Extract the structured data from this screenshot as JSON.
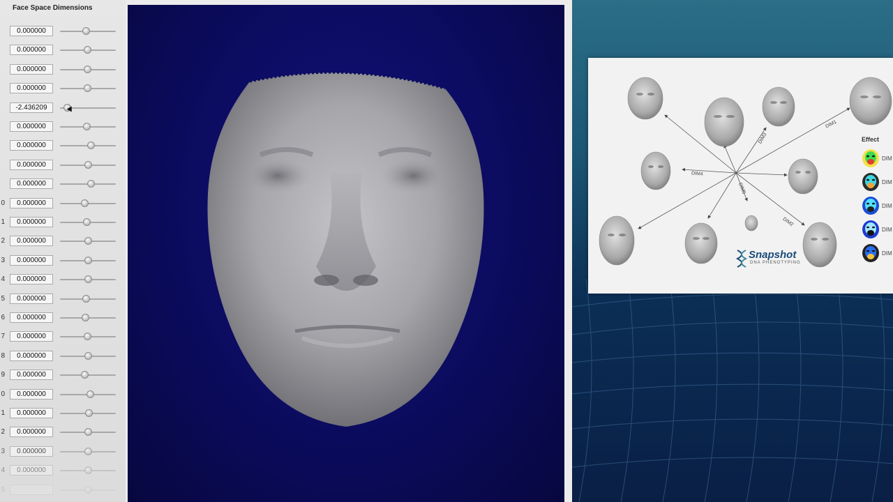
{
  "panel": {
    "title": "Face Space Dimensions",
    "rows": [
      {
        "index": "",
        "value": "0.000000"
      },
      {
        "index": "",
        "value": "0.000000"
      },
      {
        "index": "",
        "value": "0.000000"
      },
      {
        "index": "",
        "value": "0.000000"
      },
      {
        "index": "",
        "value": "-2.436209"
      },
      {
        "index": "",
        "value": "0.000000"
      },
      {
        "index": "",
        "value": "0.000000"
      },
      {
        "index": "",
        "value": "0.000000"
      },
      {
        "index": "",
        "value": "0.000000"
      },
      {
        "index": "0",
        "value": "0.000000"
      },
      {
        "index": "1",
        "value": "0.000000"
      },
      {
        "index": "2",
        "value": "0.000000"
      },
      {
        "index": "3",
        "value": "0.000000"
      },
      {
        "index": "4",
        "value": "0.000000"
      },
      {
        "index": "5",
        "value": "0.000000"
      },
      {
        "index": "6",
        "value": "0.000000"
      },
      {
        "index": "7",
        "value": "0.000000"
      },
      {
        "index": "8",
        "value": "0.000000"
      },
      {
        "index": "9",
        "value": "0.000000"
      },
      {
        "index": "0",
        "value": "0.000000"
      },
      {
        "index": "1",
        "value": "0.000000"
      },
      {
        "index": "2",
        "value": "0.000000"
      },
      {
        "index": "3",
        "value": "0.000000"
      },
      {
        "index": "4",
        "value": "0.000000"
      },
      {
        "index": "5",
        "value": ""
      }
    ]
  },
  "slide": {
    "dim_labels": [
      "DIM1",
      "DIM2",
      "DIM3",
      "DIM4",
      "DIM5"
    ],
    "effect_label": "Effect",
    "effect_dim_label": "DIM",
    "logo": "Snapshot",
    "logo_sub": "DNA PHENOTYPING"
  },
  "colors": {
    "viewport_bg": "#0b0b5e",
    "panel_bg": "#e2e2e2",
    "face": "#a9a9ad"
  }
}
